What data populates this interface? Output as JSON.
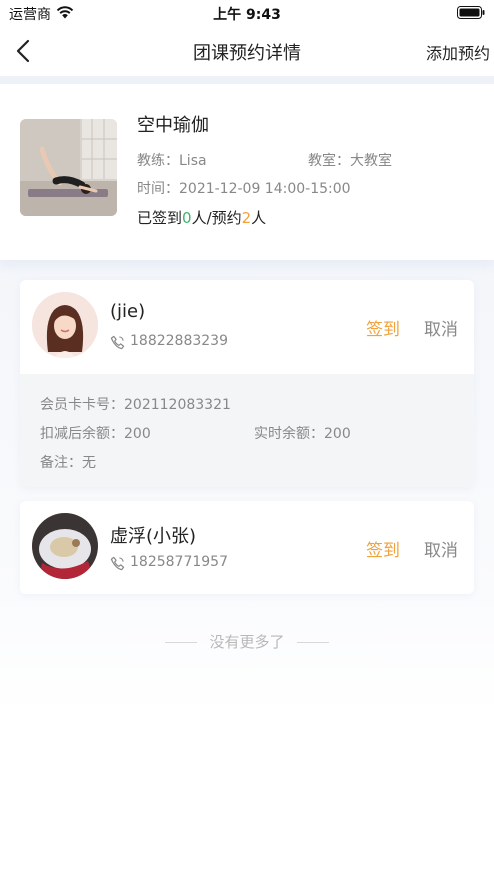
{
  "status_bar": {
    "carrier": "运营商",
    "time": "上午 9:43"
  },
  "nav": {
    "title": "团课预约详情",
    "action": "添加预约"
  },
  "course": {
    "name": "空中瑜伽",
    "teacher_label": "教练：",
    "teacher": "Lisa",
    "room_label": "教室：",
    "room": "大教室",
    "time_label": "时间：",
    "time": "2021-12-09 14:00-15:00",
    "signed_prefix": "已签到",
    "signed_count": "0",
    "signed_suffix": "人/预约",
    "booked_count": "2",
    "booked_suffix": "人"
  },
  "members": [
    {
      "name": "(jie)",
      "phone": "18822883239",
      "checkin_label": "签到",
      "cancel_label": "取消",
      "card_no": "会员卡卡号：202112083321",
      "deduct": "扣减后余额：200",
      "balance": "实时余额：200",
      "note": "备注：无"
    },
    {
      "name": "虚浮(小张)",
      "phone": "18258771957",
      "checkin_label": "签到",
      "cancel_label": "取消"
    }
  ],
  "footer": {
    "end_text": "没有更多了"
  },
  "colors": {
    "accent_orange": "#f0a23c",
    "accent_green": "#3cb56b",
    "muted": "#888888"
  }
}
